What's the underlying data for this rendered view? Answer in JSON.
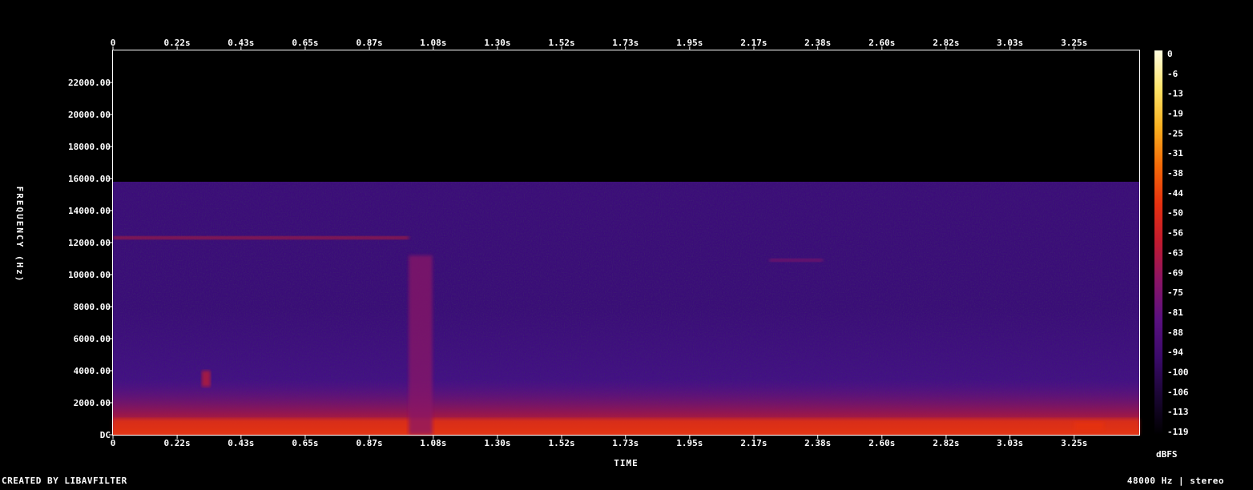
{
  "chart_data": {
    "type": "heatmap",
    "xlabel": "TIME",
    "ylabel": "FREQUENCY (Hz)",
    "colorbar_label": "dBFS",
    "x_ticks": [
      "0",
      "0.22s",
      "0.43s",
      "0.65s",
      "0.87s",
      "1.08s",
      "1.30s",
      "1.52s",
      "1.73s",
      "1.95s",
      "2.17s",
      "2.38s",
      "2.60s",
      "2.82s",
      "3.03s",
      "3.25s"
    ],
    "x_tick_values": [
      0,
      0.217,
      0.433,
      0.65,
      0.867,
      1.083,
      1.3,
      1.517,
      1.733,
      1.95,
      2.167,
      2.383,
      2.6,
      2.817,
      3.033,
      3.25
    ],
    "xlim": [
      0,
      3.47
    ],
    "y_ticks": [
      "DC",
      "2000.00",
      "4000.00",
      "6000.00",
      "8000.00",
      "10000.00",
      "12000.00",
      "14000.00",
      "16000.00",
      "18000.00",
      "20000.00",
      "22000.00"
    ],
    "y_tick_values": [
      0,
      2000,
      4000,
      6000,
      8000,
      10000,
      12000,
      14000,
      16000,
      18000,
      20000,
      22000
    ],
    "ylim": [
      0,
      24000
    ],
    "content_max_hz": 15800,
    "colorbar_ticks": [
      "0",
      "-6",
      "-13",
      "-19",
      "-25",
      "-31",
      "-38",
      "-44",
      "-50",
      "-56",
      "-63",
      "-69",
      "-75",
      "-81",
      "-88",
      "-94",
      "-100",
      "-106",
      "-113",
      "-119"
    ],
    "colorbar_range": [
      -119,
      0
    ],
    "colormap": [
      "#000000",
      "#1a0633",
      "#3a0a6a",
      "#5a1080",
      "#8a1466",
      "#c01a30",
      "#e63010",
      "#f46a08",
      "#f9b020",
      "#fde468",
      "#fffde0"
    ],
    "features": [
      {
        "label": "low-frequency energy",
        "t": [
          0,
          3.47
        ],
        "hz": [
          0,
          1000
        ],
        "dbfs": -45
      },
      {
        "label": "broadband transient",
        "t": [
          1.0,
          1.08
        ],
        "hz": [
          0,
          11200
        ],
        "dbfs": -70
      },
      {
        "label": "tone band",
        "t": [
          0,
          1.0
        ],
        "hz": [
          12200,
          12400
        ],
        "dbfs": -65
      },
      {
        "label": "burst",
        "t": [
          0.3,
          0.33
        ],
        "hz": [
          3000,
          4000
        ],
        "dbfs": -60
      },
      {
        "label": "chirp",
        "t": [
          2.22,
          2.4
        ],
        "hz": [
          10800,
          11000
        ],
        "dbfs": -66
      },
      {
        "label": "burst",
        "t": [
          3.25,
          3.35
        ],
        "hz": [
          200,
          800
        ],
        "dbfs": -50
      }
    ]
  },
  "footer": {
    "created_by": "CREATED BY LIBAVFILTER",
    "format": "48000 Hz | stereo"
  }
}
